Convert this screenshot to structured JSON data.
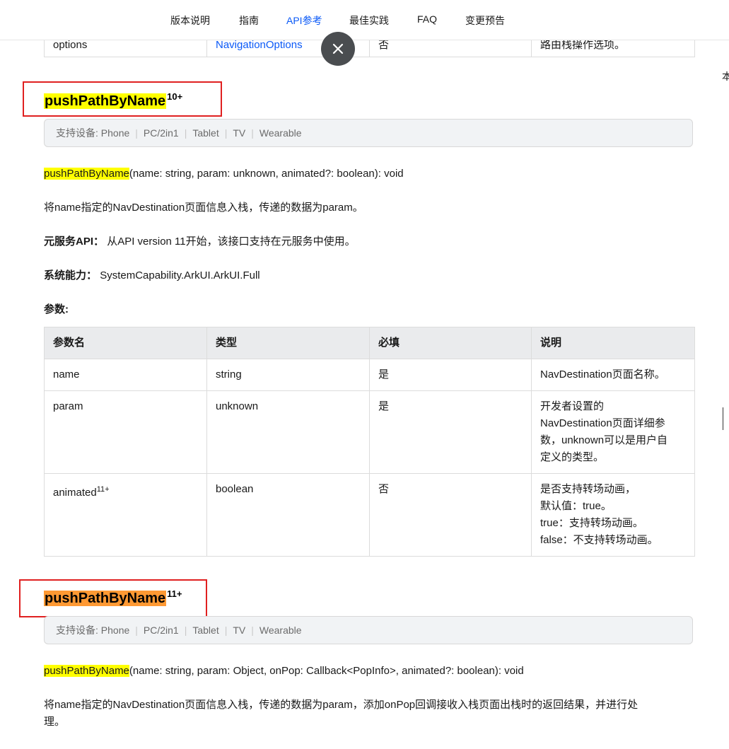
{
  "nav": {
    "items": [
      "版本说明",
      "指南",
      "API参考",
      "最佳实践",
      "FAQ",
      "变更预告"
    ],
    "active_index": 2,
    "active_color": "#0a59f7"
  },
  "right_edge_text": "本",
  "prev_table": {
    "row": [
      "options",
      "NavigationOptions",
      "否",
      "路由栈操作选项。"
    ]
  },
  "close_button": {
    "icon": "close-icon"
  },
  "section1": {
    "name": "pushPathByName",
    "version": "10+",
    "highlight_color": "#ffff00",
    "devices_label": "支持设备: Phone",
    "devices": [
      "PC/2in1",
      "Tablet",
      "TV",
      "Wearable"
    ],
    "signature_name": "pushPathByName",
    "signature_rest": "(name: string, param: unknown, animated?: boolean): void",
    "description": "将name指定的NavDestination页面信息入栈，传递的数据为param。",
    "atomic_label": "元服务API：",
    "atomic_text": "从API version 11开始，该接口支持在元服务中使用。",
    "syscap_label": "系统能力：",
    "syscap_text": "SystemCapability.ArkUI.ArkUI.Full",
    "params_label": "参数:",
    "table": {
      "headers": [
        "参数名",
        "类型",
        "必填",
        "说明"
      ],
      "rows": [
        {
          "name": "name",
          "sup": "",
          "type": "string",
          "required": "是",
          "desc": [
            "NavDestination页面名称。"
          ]
        },
        {
          "name": "param",
          "sup": "",
          "type": "unknown",
          "required": "是",
          "desc": [
            "开发者设置的",
            "NavDestination页面详细参",
            "数，unknown可以是用户自",
            "定义的类型。"
          ]
        },
        {
          "name": "animated",
          "sup": "11+",
          "type": "boolean",
          "required": "否",
          "desc": [
            "是否支持转场动画，",
            "默认值：true。",
            "true：支持转场动画。",
            "false：不支持转场动画。"
          ]
        }
      ]
    }
  },
  "section2": {
    "name": "pushPathByName",
    "version": "11+",
    "highlight_color": "#ff9933",
    "devices_label": "支持设备: Phone",
    "devices": [
      "PC/2in1",
      "Tablet",
      "TV",
      "Wearable"
    ],
    "signature_name": "pushPathByName",
    "signature_rest": "(name: string, param: Object, onPop: Callback<PopInfo>, animated?: boolean): void",
    "description_line1": "将name指定的NavDestination页面信息入栈，传递的数据为param，添加onPop回调接收入栈页面出栈时的返回结果，并进行处",
    "description_line2": "理。"
  }
}
